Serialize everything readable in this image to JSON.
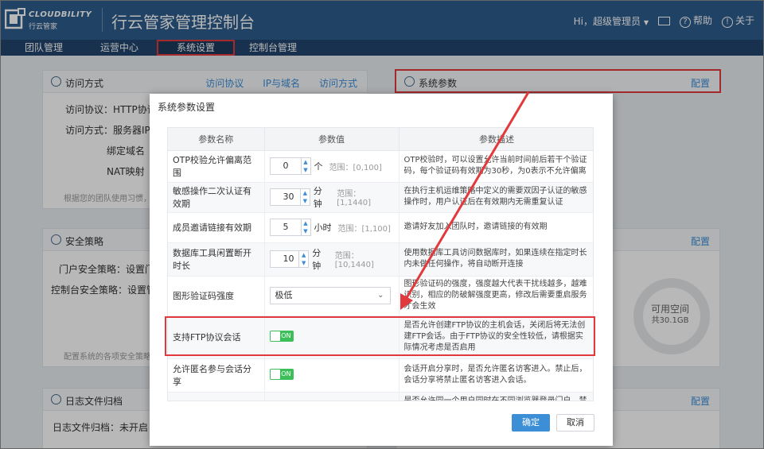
{
  "header": {
    "logo_en": "CLOUDBILITY",
    "logo_cn": "行云管家",
    "app_title": "行云管家管理控制台",
    "user_greeting": "Hi，超级管理员",
    "help_label": "帮助",
    "about_label": "关于"
  },
  "nav": {
    "items": [
      {
        "label": "团队管理"
      },
      {
        "label": "运营中心"
      },
      {
        "label": "系统设置"
      },
      {
        "label": "控制台管理"
      }
    ]
  },
  "bg": {
    "access": {
      "title": "访问方式",
      "links": [
        "访问协议",
        "IP与域名",
        "访问方式"
      ],
      "rows": [
        "访问协议：HTTP协议，",
        "访问方式：服务器IP（",
        "绑定域名（",
        "NAT映射（"
      ],
      "note": "根据您的团队使用习惯，您"
    },
    "system_params": {
      "title": "系统参数",
      "config": "配置"
    },
    "security": {
      "title": "安全策略",
      "config": "配置",
      "rows": [
        "门户安全策略：设置门户",
        "控制台安全策略：设置管理"
      ],
      "note": "配置系统的各项安全策略，"
    },
    "storage": {
      "config": "配置",
      "available_label": "可用空间",
      "available_value": "共30.1GB"
    },
    "log": {
      "title": "日志文件归档",
      "row": "日志文件归档：未开启"
    }
  },
  "modal": {
    "title": "系统参数设置",
    "columns": [
      "参数名称",
      "参数值",
      "参数描述"
    ],
    "rows": [
      {
        "name": "OTP校验允许偏离范围",
        "value": "0",
        "unit": "个",
        "range": "范围：[0,100]",
        "desc": "OTP校验时，可以设置允许当前时间前后若干个验证码，每个验证码有效期为30秒，为0表示不允许偏离"
      },
      {
        "name": "敏感操作二次认证有效期",
        "value": "30",
        "unit": "分钟",
        "range": "范围：[1,1440]",
        "desc": "在执行主机运维策略中定义的需要双因子认证的敏感操作时，用户认证后在有效期内无需重复认证"
      },
      {
        "name": "成员邀请链接有效期",
        "value": "5",
        "unit": "小时",
        "range": "范围：[1,100]",
        "desc": "邀请好友加入团队时，邀请链接的有效期"
      },
      {
        "name": "数据库工具闲置断开时长",
        "value": "10",
        "unit": "分钟",
        "range": "范围：[10,1440]",
        "desc": "使用数据库工具访问数据库时，如果连续在指定时长内未做任何操作，将自动断开连接"
      },
      {
        "name": "图形验证码强度",
        "select": "极低",
        "desc": "图形验证码的强度，强度越大代表干扰线越多，越难识别，相应的防破解强度更高，修改后需要重启服务才会生效"
      },
      {
        "name": "支持FTP协议会话",
        "toggle": "ON",
        "desc": "是否允许创建FTP协议的主机会话，关闭后将无法创建FTP会话。由于FTP协议的安全性较低，请根据实际情况考虑是否启用"
      },
      {
        "name": "允许匿名参与会话分享",
        "toggle": "ON",
        "desc": "会话开启分享时，是否允许匿名访客进入。禁止后，会话分享将禁止匿名访客进入会话。"
      },
      {
        "name": "",
        "desc": "是否允许同一个用户同时在不同浏览器登录门户，禁止后"
      }
    ],
    "ok_label": "确定",
    "cancel_label": "取消"
  },
  "colors": {
    "header": "#2d5c8d",
    "nav": "#21456c",
    "accent": "#3c8ed7",
    "toggle_on": "#3cbe5a",
    "highlight": "#e2393c"
  }
}
